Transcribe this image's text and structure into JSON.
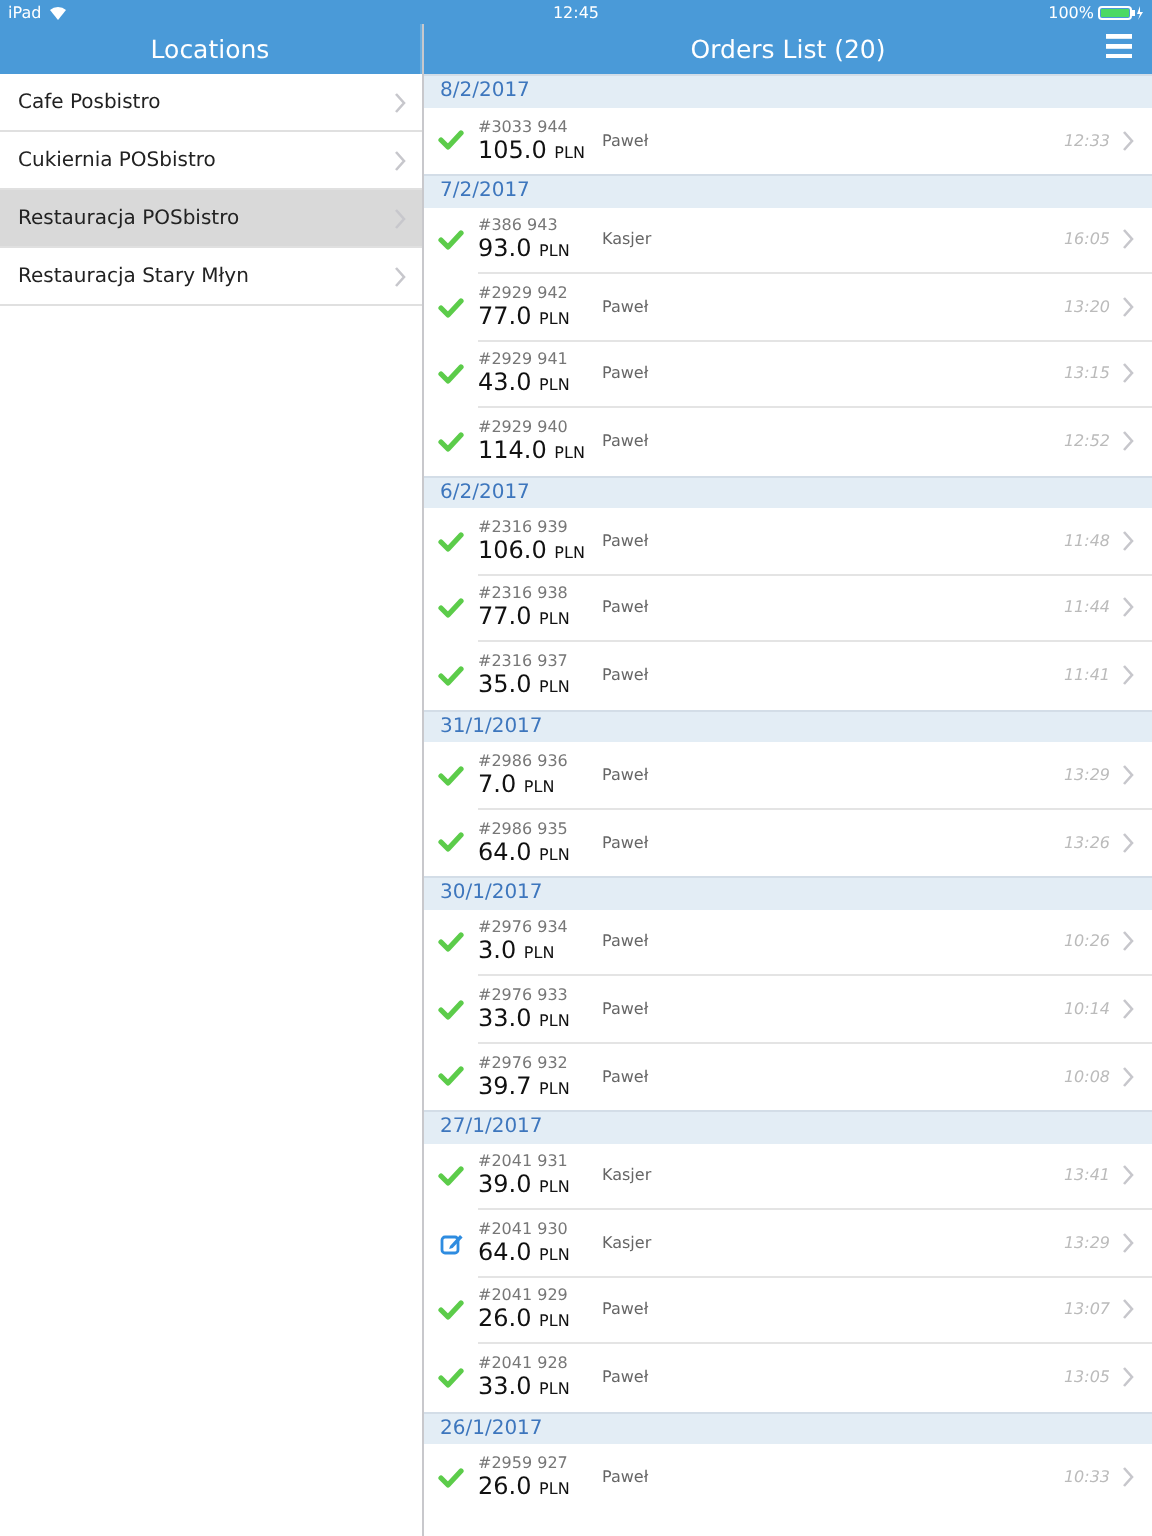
{
  "status_bar": {
    "device": "iPad",
    "time": "12:45",
    "battery": "100%"
  },
  "locations": {
    "title": "Locations",
    "items": [
      {
        "label": "Cafe Posbistro",
        "selected": false
      },
      {
        "label": "Cukiernia POSbistro",
        "selected": false
      },
      {
        "label": "Restauracja POSbistro",
        "selected": true
      },
      {
        "label": "Restauracja Stary Młyn",
        "selected": false
      }
    ]
  },
  "orders": {
    "title": "Orders List (20)",
    "groups": [
      {
        "date": "8/2/2017",
        "orders": [
          {
            "kind": "done",
            "number": "#3033 944",
            "amount": "105.0",
            "currency": "PLN",
            "user": "Paweł",
            "time": "12:33"
          }
        ]
      },
      {
        "date": "7/2/2017",
        "orders": [
          {
            "kind": "done",
            "number": "#386 943",
            "amount": "93.0",
            "currency": "PLN",
            "user": "Kasjer",
            "time": "16:05"
          },
          {
            "kind": "done",
            "number": "#2929 942",
            "amount": "77.0",
            "currency": "PLN",
            "user": "Paweł",
            "time": "13:20"
          },
          {
            "kind": "done",
            "number": "#2929 941",
            "amount": "43.0",
            "currency": "PLN",
            "user": "Paweł",
            "time": "13:15"
          },
          {
            "kind": "done",
            "number": "#2929 940",
            "amount": "114.0",
            "currency": "PLN",
            "user": "Paweł",
            "time": "12:52"
          }
        ]
      },
      {
        "date": "6/2/2017",
        "orders": [
          {
            "kind": "done",
            "number": "#2316 939",
            "amount": "106.0",
            "currency": "PLN",
            "user": "Paweł",
            "time": "11:48"
          },
          {
            "kind": "done",
            "number": "#2316 938",
            "amount": "77.0",
            "currency": "PLN",
            "user": "Paweł",
            "time": "11:44"
          },
          {
            "kind": "done",
            "number": "#2316 937",
            "amount": "35.0",
            "currency": "PLN",
            "user": "Paweł",
            "time": "11:41"
          }
        ]
      },
      {
        "date": "31/1/2017",
        "orders": [
          {
            "kind": "done",
            "number": "#2986 936",
            "amount": "7.0",
            "currency": "PLN",
            "user": "Paweł",
            "time": "13:29"
          },
          {
            "kind": "done",
            "number": "#2986 935",
            "amount": "64.0",
            "currency": "PLN",
            "user": "Paweł",
            "time": "13:26"
          }
        ]
      },
      {
        "date": "30/1/2017",
        "orders": [
          {
            "kind": "done",
            "number": "#2976 934",
            "amount": "3.0",
            "currency": "PLN",
            "user": "Paweł",
            "time": "10:26"
          },
          {
            "kind": "done",
            "number": "#2976 933",
            "amount": "33.0",
            "currency": "PLN",
            "user": "Paweł",
            "time": "10:14"
          },
          {
            "kind": "done",
            "number": "#2976 932",
            "amount": "39.7",
            "currency": "PLN",
            "user": "Paweł",
            "time": "10:08"
          }
        ]
      },
      {
        "date": "27/1/2017",
        "orders": [
          {
            "kind": "done",
            "number": "#2041 931",
            "amount": "39.0",
            "currency": "PLN",
            "user": "Kasjer",
            "time": "13:41"
          },
          {
            "kind": "edit",
            "number": "#2041 930",
            "amount": "64.0",
            "currency": "PLN",
            "user": "Kasjer",
            "time": "13:29"
          },
          {
            "kind": "done",
            "number": "#2041 929",
            "amount": "26.0",
            "currency": "PLN",
            "user": "Paweł",
            "time": "13:07"
          },
          {
            "kind": "done",
            "number": "#2041 928",
            "amount": "33.0",
            "currency": "PLN",
            "user": "Paweł",
            "time": "13:05"
          }
        ]
      },
      {
        "date": "26/1/2017",
        "orders": [
          {
            "kind": "done",
            "number": "#2959 927",
            "amount": "26.0",
            "currency": "PLN",
            "user": "Paweł",
            "time": "10:33"
          }
        ]
      }
    ]
  }
}
